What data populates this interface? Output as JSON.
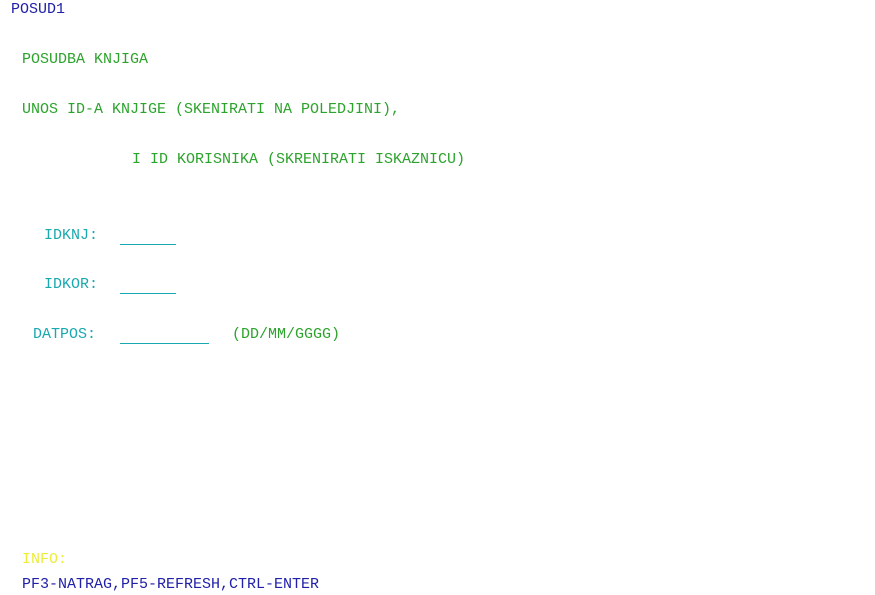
{
  "screen_id": "POSUD1",
  "title": "POSUDBA KNJIGA",
  "instruction_line1": "UNOS ID-A KNJIGE (SKENIRATI NA POLEDJINI),",
  "instruction_line2": "I ID KORISNIKA (SKRENIRATI ISKAZNICU)",
  "fields": {
    "idknj": {
      "label": "IDKNJ:",
      "value": ""
    },
    "idkor": {
      "label": "IDKOR:",
      "value": ""
    },
    "datpos": {
      "label": "DATPOS:",
      "value": "",
      "format_hint": "(DD/MM/GGGG)"
    }
  },
  "info_label": "INFO:",
  "function_keys": "PF3-NATRAG,PF5-REFRESH,CTRL-ENTER",
  "colors": {
    "header": "#2020a8",
    "text": "#2ca32c",
    "label": "#1aa8b0",
    "info": "#ecec3c"
  }
}
